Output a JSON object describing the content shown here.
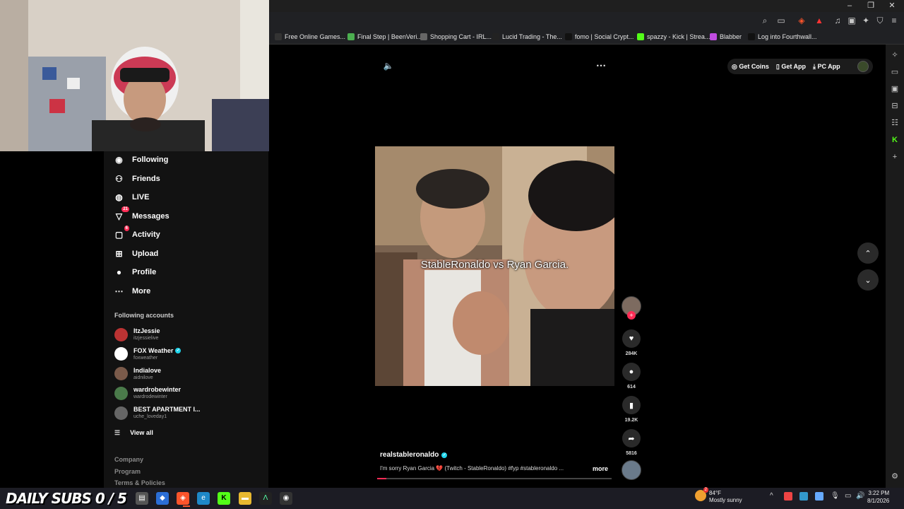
{
  "browser": {
    "window_controls": [
      "–",
      "❐",
      "✕"
    ],
    "bookmarks": [
      {
        "label": "Free Online Games...",
        "icon": "vs-icon",
        "color": "#333"
      },
      {
        "label": "Final Step | BeenVeri...",
        "icon": "check-icon",
        "color": "#4caf50"
      },
      {
        "label": "Shopping Cart - IRL...",
        "icon": "globe-icon",
        "color": "#666"
      },
      {
        "label": "Lucid Trading - The...",
        "icon": "lucid-icon",
        "color": "#222"
      },
      {
        "label": "fomo | Social Crypt...",
        "icon": "fomo-icon",
        "color": "#111"
      },
      {
        "label": "spazzy - Kick | Strea...",
        "icon": "kick-icon",
        "color": "#53fc18"
      },
      {
        "label": "Blabber",
        "icon": "blabber-icon",
        "color": "#c04ce0"
      },
      {
        "label": "Log into Fourthwall...",
        "icon": "fourthwall-icon",
        "color": "#111"
      }
    ]
  },
  "sidebar": {
    "nav": [
      {
        "label": "Following",
        "icon": "following-avatar-icon",
        "badge": ""
      },
      {
        "label": "Friends",
        "icon": "friends-icon",
        "badge": ""
      },
      {
        "label": "LIVE",
        "icon": "live-icon",
        "badge": ""
      },
      {
        "label": "Messages",
        "icon": "messages-icon",
        "badge": "21"
      },
      {
        "label": "Activity",
        "icon": "activity-icon",
        "badge": "6"
      },
      {
        "label": "Upload",
        "icon": "upload-icon",
        "badge": ""
      },
      {
        "label": "Profile",
        "icon": "profile-icon",
        "badge": ""
      },
      {
        "label": "More",
        "icon": "more-icon",
        "badge": ""
      }
    ],
    "following_heading": "Following accounts",
    "accounts": [
      {
        "name": "ItzJessie",
        "handle": "itzjessielive",
        "verified": false,
        "color": "#b33"
      },
      {
        "name": "FOX Weather",
        "handle": "foxweather",
        "verified": true,
        "color": "#fff"
      },
      {
        "name": "Indialove",
        "handle": "aidnilove",
        "verified": false,
        "color": "#7a5a4a"
      },
      {
        "name": "wardrobewinter",
        "handle": "wardrodewinter",
        "verified": false,
        "color": "#4a7a4a"
      },
      {
        "name": "BEST APARTMENT I...",
        "handle": "uche_loveday1",
        "verified": false,
        "color": "#666"
      }
    ],
    "view_all": "View all",
    "footer": [
      "Company",
      "Program",
      "Terms & Policies"
    ]
  },
  "top_actions": {
    "get_coins": "Get Coins",
    "get_app": "Get App",
    "pc_app": "PC App"
  },
  "video": {
    "overlay_text": "StableRonaldo vs Ryan Garcia.",
    "author": "realstableronaldo",
    "description": "I'm sorry Ryan Garcia 💔 (Twitch - StableRonaldo) #fyp #stableronaldo ...",
    "more": "more"
  },
  "actions": {
    "likes": "284K",
    "comments": "614",
    "saves": "19.2K",
    "shares": "5816"
  },
  "taskbar": {
    "subs_text": "DAILY SUBS 0 / 5",
    "weather_temp": "84°F",
    "weather_desc": "Mostly sunny",
    "weather_badge": "2",
    "time": "3:22 PM",
    "date": "8/1/2026"
  }
}
